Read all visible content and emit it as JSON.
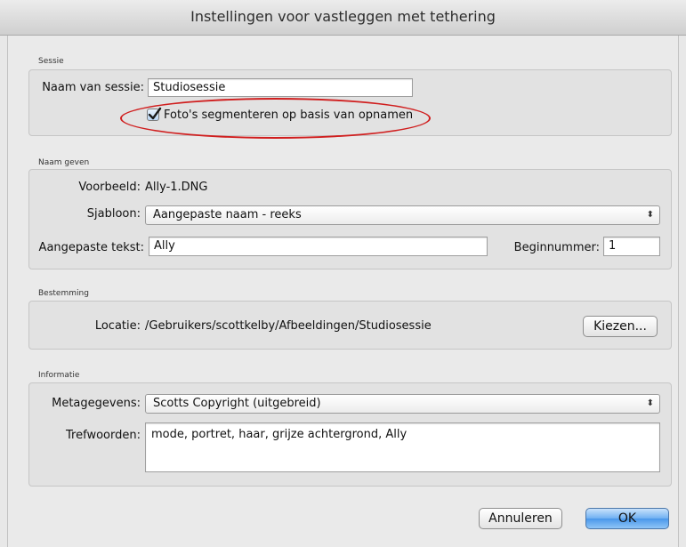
{
  "window": {
    "title": "Instellingen voor vastleggen met tethering"
  },
  "session": {
    "section_label": "Sessie",
    "name_label": "Naam van sessie:",
    "name_value": "Studiosessie",
    "segment_checked": true,
    "segment_label": "Foto's segmenteren op basis van opnamen"
  },
  "naming": {
    "section_label": "Naam geven",
    "example_label": "Voorbeeld:",
    "example_value": "Ally-1.DNG",
    "template_label": "Sjabloon:",
    "template_value": "Aangepaste naam - reeks",
    "custom_text_label": "Aangepaste tekst:",
    "custom_text_value": "Ally",
    "start_number_label": "Beginnummer:",
    "start_number_value": "1"
  },
  "destination": {
    "section_label": "Bestemming",
    "location_label": "Locatie:",
    "location_value": "/Gebruikers/scottkelby/Afbeeldingen/Studiosessie",
    "choose_button": "Kiezen..."
  },
  "information": {
    "section_label": "Informatie",
    "metadata_label": "Metagegevens:",
    "metadata_value": "Scotts Copyright (uitgebreid)",
    "keywords_label": "Trefwoorden:",
    "keywords_value": "mode, portret, haar, grijze achtergrond, Ally"
  },
  "buttons": {
    "cancel": "Annuleren",
    "ok": "OK"
  },
  "colors": {
    "annotation_ellipse": "#d01e1e",
    "default_button": "#4a97ea"
  },
  "icons": {
    "checkbox": "checkmark-icon",
    "popup": "updown-arrows-icon"
  }
}
